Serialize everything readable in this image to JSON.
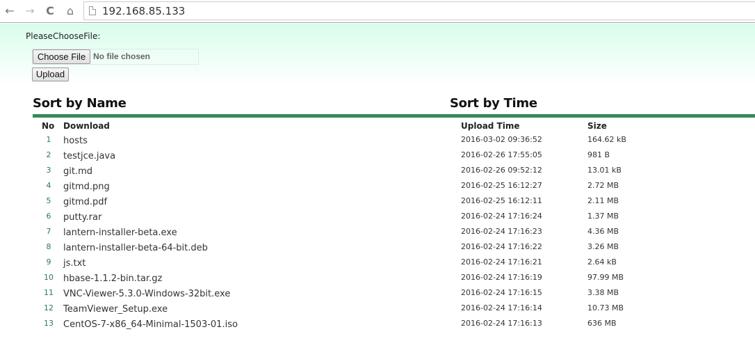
{
  "browser": {
    "url": "192.168.85.133",
    "icons": {
      "back": "←",
      "forward": "→",
      "reload": "C",
      "home": "⌂"
    }
  },
  "upload": {
    "label": "PleaseChooseFile:",
    "choose_button": "Choose File",
    "no_file_text": "No file chosen",
    "upload_button": "Upload"
  },
  "sort": {
    "by_name": "Sort by Name",
    "by_time": "Sort by Time"
  },
  "accent_color": "#358a57",
  "table": {
    "headers": {
      "no": "No",
      "download": "Download",
      "upload_time": "Upload Time",
      "size": "Size"
    },
    "rows": [
      {
        "no": "1",
        "name": "hosts",
        "time": "2016-03-02 09:36:52",
        "size": "164.62 kB"
      },
      {
        "no": "2",
        "name": "testjce.java",
        "time": "2016-02-26 17:55:05",
        "size": "981 B"
      },
      {
        "no": "3",
        "name": "git.md",
        "time": "2016-02-26 09:52:12",
        "size": "13.01 kB"
      },
      {
        "no": "4",
        "name": "gitmd.png",
        "time": "2016-02-25 16:12:27",
        "size": "2.72 MB"
      },
      {
        "no": "5",
        "name": "gitmd.pdf",
        "time": "2016-02-25 16:12:11",
        "size": "2.11 MB"
      },
      {
        "no": "6",
        "name": "putty.rar",
        "time": "2016-02-24 17:16:24",
        "size": "1.37 MB"
      },
      {
        "no": "7",
        "name": "lantern-installer-beta.exe",
        "time": "2016-02-24 17:16:23",
        "size": "4.36 MB"
      },
      {
        "no": "8",
        "name": "lantern-installer-beta-64-bit.deb",
        "time": "2016-02-24 17:16:22",
        "size": "3.26 MB"
      },
      {
        "no": "9",
        "name": "js.txt",
        "time": "2016-02-24 17:16:21",
        "size": "2.64 kB"
      },
      {
        "no": "10",
        "name": "hbase-1.1.2-bin.tar.gz",
        "time": "2016-02-24 17:16:19",
        "size": "97.99 MB"
      },
      {
        "no": "11",
        "name": "VNC-Viewer-5.3.0-Windows-32bit.exe",
        "time": "2016-02-24 17:16:15",
        "size": "3.38 MB"
      },
      {
        "no": "12",
        "name": "TeamViewer_Setup.exe",
        "time": "2016-02-24 17:16:14",
        "size": "10.73 MB"
      },
      {
        "no": "13",
        "name": "CentOS-7-x86_64-Minimal-1503-01.iso",
        "time": "2016-02-24 17:16:13",
        "size": "636 MB"
      }
    ]
  }
}
